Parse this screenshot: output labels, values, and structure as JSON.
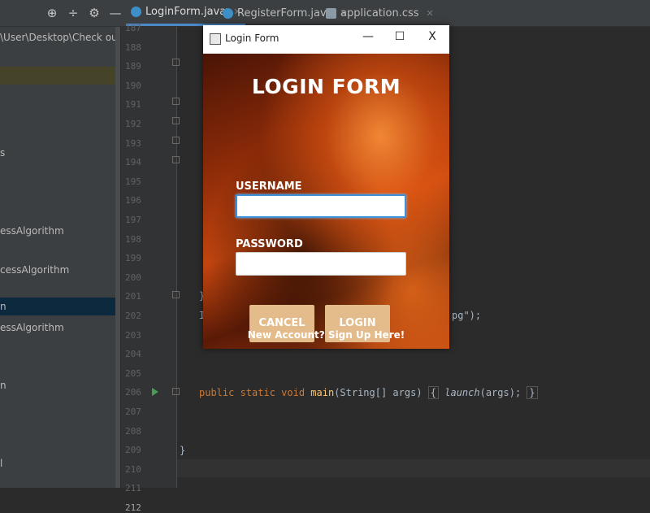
{
  "ide": {
    "tabs": [
      {
        "label": "LoginForm.java"
      },
      {
        "label": "RegisterForm.java"
      },
      {
        "label": "application.css"
      }
    ],
    "project": {
      "path": "\\User\\Desktop\\Check out\\Identi",
      "rows": [
        "s",
        "essAlgorithm",
        "cessAlgorithm",
        "n",
        "essAlgorithm",
        "n",
        "l"
      ]
    },
    "line_numbers": [
      "187",
      "188",
      "189",
      "190",
      "191",
      "192",
      "193",
      "194",
      "195",
      "196",
      "197",
      "198",
      "199",
      "200",
      "201",
      "202",
      "203",
      "204",
      "205",
      "206",
      "207",
      "208",
      "209",
      "210",
      "211",
      "212"
    ],
    "code": {
      "line201": "}",
      "line202_left": "I",
      "line202_right": "pg\");",
      "main_kw": "public static void ",
      "main_fn": "main",
      "main_args": "(String[] args) ",
      "main_brace_open": "{",
      "main_launch": "launch",
      "main_call_end": "(args); ",
      "main_brace_close": "}",
      "line211": "}"
    }
  },
  "window": {
    "title": "Login Form",
    "controls": {
      "minimize": "—",
      "maximize": "☐",
      "close": "X"
    }
  },
  "form": {
    "heading": "LOGIN FORM",
    "username_label": "USERNAME",
    "username_value": "",
    "password_label": "PASSWORD",
    "password_value": "",
    "cancel_label": "CANCEL",
    "login_label": "LOGIN",
    "signup_text": "New Account? Sign Up Here!"
  },
  "colors": {
    "ide_bg": "#2b2b2b",
    "button_bg": "#e4bb8a",
    "active_tab_underline": "#4a88c7"
  },
  "icons": [
    "crosshair-icon",
    "collapse-icon",
    "gear-icon",
    "minimize-panel-icon",
    "java-class-icon",
    "css-file-icon",
    "run-arrow-icon",
    "window-app-icon"
  ]
}
